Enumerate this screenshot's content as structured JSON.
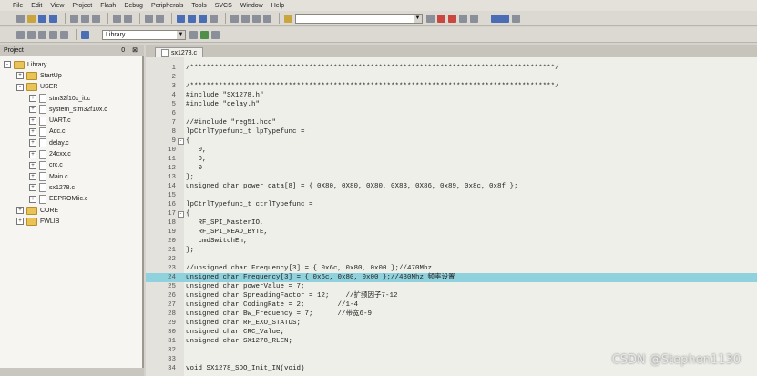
{
  "menu": [
    "File",
    "Edit",
    "View",
    "Project",
    "Flash",
    "Debug",
    "Peripherals",
    "Tools",
    "SVCS",
    "Window",
    "Help"
  ],
  "toolbar": {
    "target_combo": "Library",
    "combo_arrow": "▼"
  },
  "project_panel": {
    "title": "Project",
    "controls": "0 ⊠",
    "tree": [
      {
        "label": "Library",
        "level": 0,
        "kind": "root",
        "expander": "-"
      },
      {
        "label": "StartUp",
        "level": 1,
        "kind": "folder",
        "expander": "+"
      },
      {
        "label": "USER",
        "level": 1,
        "kind": "folder",
        "expander": "-"
      },
      {
        "label": "stm32f10x_it.c",
        "level": 2,
        "kind": "file",
        "expander": "+"
      },
      {
        "label": "system_stm32f10x.c",
        "level": 2,
        "kind": "file",
        "expander": "+"
      },
      {
        "label": "UART.c",
        "level": 2,
        "kind": "file",
        "expander": "+"
      },
      {
        "label": "Adc.c",
        "level": 2,
        "kind": "file",
        "expander": "+"
      },
      {
        "label": "delay.c",
        "level": 2,
        "kind": "file",
        "expander": "+"
      },
      {
        "label": "24cxx.c",
        "level": 2,
        "kind": "file",
        "expander": "+"
      },
      {
        "label": "crc.c",
        "level": 2,
        "kind": "file",
        "expander": "+"
      },
      {
        "label": "Main.c",
        "level": 2,
        "kind": "file",
        "expander": "+"
      },
      {
        "label": "sx1278.c",
        "level": 2,
        "kind": "file",
        "expander": "+"
      },
      {
        "label": "EEPROMiic.c",
        "level": 2,
        "kind": "file",
        "expander": "+"
      },
      {
        "label": "CORE",
        "level": 1,
        "kind": "folder",
        "expander": "+"
      },
      {
        "label": "FWLIB",
        "level": 1,
        "kind": "folder",
        "expander": "+"
      }
    ]
  },
  "editor": {
    "tab": "sx1278.c",
    "lines": [
      {
        "n": "1",
        "text": "/*****************************************************************************************/",
        "fold": ""
      },
      {
        "n": "2",
        "text": "",
        "fold": ""
      },
      {
        "n": "3",
        "text": "/*****************************************************************************************/",
        "fold": ""
      },
      {
        "n": "4",
        "text": "#include \"SX1278.h\"",
        "fold": ""
      },
      {
        "n": "5",
        "text": "#include \"delay.h\"",
        "fold": ""
      },
      {
        "n": "6",
        "text": "",
        "fold": ""
      },
      {
        "n": "7",
        "text": "//#include \"reg51.hcd\"",
        "fold": ""
      },
      {
        "n": "8",
        "text": "lpCtrlTypefunc_t lpTypefunc =",
        "fold": ""
      },
      {
        "n": "9",
        "text": "{",
        "fold": "-"
      },
      {
        "n": "10",
        "text": "   0,",
        "fold": ""
      },
      {
        "n": "11",
        "text": "   0,",
        "fold": ""
      },
      {
        "n": "12",
        "text": "   0",
        "fold": ""
      },
      {
        "n": "13",
        "text": "};",
        "fold": ""
      },
      {
        "n": "14",
        "text": "unsigned char power_data[8] = { 0X80, 0X80, 0X80, 0X83, 0X86, 0x89, 0x8c, 0x8f };",
        "fold": ""
      },
      {
        "n": "15",
        "text": "",
        "fold": ""
      },
      {
        "n": "16",
        "text": "lpCtrlTypefunc_t ctrlTypefunc =",
        "fold": ""
      },
      {
        "n": "17",
        "text": "{",
        "fold": "-"
      },
      {
        "n": "18",
        "text": "   RF_SPI_MasterIO,",
        "fold": ""
      },
      {
        "n": "19",
        "text": "   RF_SPI_READ_BYTE,",
        "fold": ""
      },
      {
        "n": "20",
        "text": "   cmdSwitchEn,",
        "fold": ""
      },
      {
        "n": "21",
        "text": "};",
        "fold": ""
      },
      {
        "n": "22",
        "text": "",
        "fold": ""
      },
      {
        "n": "23",
        "text": "//unsigned char Frequency[3] = { 0x6c, 0x80, 0x00 };//470Mhz",
        "fold": ""
      },
      {
        "n": "24",
        "text": "unsigned char Frequency[3] = { 0x6c, 0x80, 0x00 };//430Mhz 频率设置",
        "fold": "",
        "highlight": true
      },
      {
        "n": "25",
        "text": "unsigned char powerValue = 7;",
        "fold": ""
      },
      {
        "n": "26",
        "text": "unsigned char SpreadingFactor = 12;    //扩频因子7-12",
        "fold": ""
      },
      {
        "n": "27",
        "text": "unsigned char CodingRate = 2;        //1-4",
        "fold": ""
      },
      {
        "n": "28",
        "text": "unsigned char Bw_Frequency = 7;      //带宽6-9",
        "fold": ""
      },
      {
        "n": "29",
        "text": "unsigned char RF_EXO_STATUS;",
        "fold": ""
      },
      {
        "n": "30",
        "text": "unsigned char CRC_Value;",
        "fold": ""
      },
      {
        "n": "31",
        "text": "unsigned char SX1278_RLEN;",
        "fold": ""
      },
      {
        "n": "32",
        "text": "",
        "fold": ""
      },
      {
        "n": "33",
        "text": "",
        "fold": ""
      },
      {
        "n": "34",
        "text": "void SX1278_SDO_Init_IN(void)",
        "fold": ""
      }
    ]
  },
  "watermark": "CSDN @Stephen1130"
}
